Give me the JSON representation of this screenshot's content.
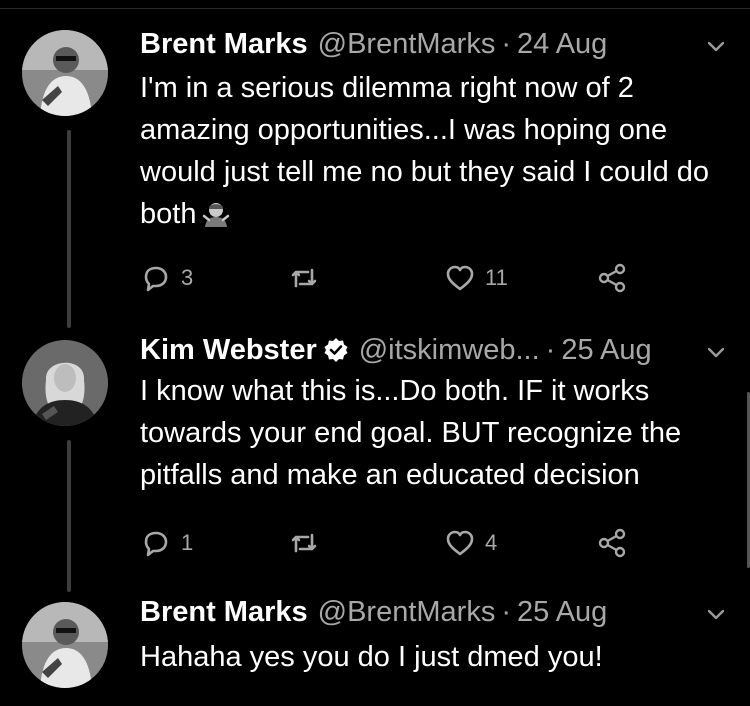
{
  "tweets": [
    {
      "name": "Brent Marks",
      "handle": "@BrentMarks",
      "dot": "·",
      "time": "24 Aug",
      "text": "I'm in a serious dilemma right now of 2 amazing opportunities...I was hoping one would just tell me no but they said I could do both",
      "reply_count": "3",
      "retweet_count": "",
      "like_count": "11"
    },
    {
      "name": "Kim Webster",
      "verified": true,
      "handle": "@itskimweb...",
      "dot": "·",
      "time": "25 Aug",
      "text": "I know what this is...Do both. IF it works towards your end goal. BUT recognize the pitfalls and make an educated decision",
      "reply_count": "1",
      "retweet_count": "",
      "like_count": "4"
    },
    {
      "name": "Brent Marks",
      "handle": "@BrentMarks",
      "dot": "·",
      "time": "25 Aug",
      "text": "Hahaha yes you do I just dmed you!"
    }
  ],
  "icons": {
    "reply": "reply-icon",
    "retweet": "retweet-icon",
    "like": "heart-icon",
    "share": "share-icon",
    "menu": "chevron-down-icon",
    "verified": "verified-badge-icon",
    "emoji": "person-shrugging-emoji"
  },
  "colors": {
    "background": "#000000",
    "text": "#ffffff",
    "secondary": "#a8a8a8",
    "thread_line": "#3d3d3d"
  }
}
